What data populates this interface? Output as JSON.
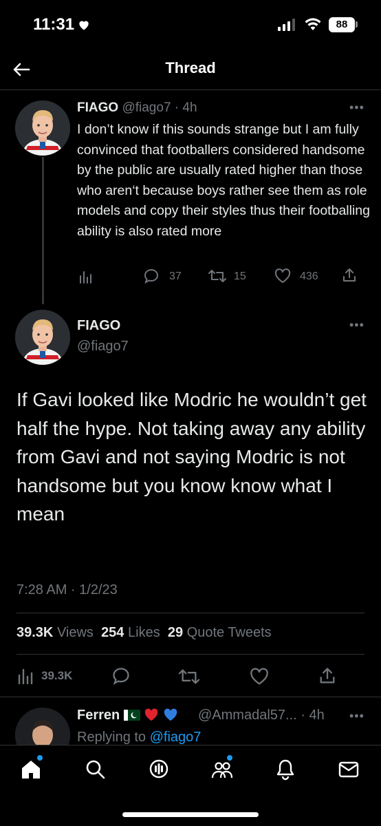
{
  "status_bar": {
    "time": "11:31",
    "battery": "88"
  },
  "header": {
    "title": "Thread"
  },
  "tweet1": {
    "name": "FIAGO",
    "handle": "@fiago7",
    "age": "4h",
    "text": "I don’t know if this sounds strange but I am fully convinced that footballers considered handsome by the public are usually rated higher than those who aren‘t because boys rather see them as role models and copy their styles thus their footballing ability is also rated more",
    "replies": "37",
    "retweets": "15",
    "likes": "436"
  },
  "main_tweet": {
    "name": "FIAGO",
    "handle": "@fiago7",
    "text": "If Gavi looked like Modric he wouldn’t get half the hype. Not taking away any ability from Gavi and not saying Modric is not handsome but you know know what I mean",
    "timestamp": "7:28 AM · 1/2/23",
    "views_count": "39.3K",
    "views_label": "Views",
    "likes_count": "254",
    "likes_label": "Likes",
    "quotes_count": "29",
    "quotes_label": "Quote Tweets",
    "action_views": "39.3K"
  },
  "reply": {
    "name": "Ferren",
    "handle": "@Ammadal57...",
    "age": "4h",
    "replying_prefix": "Replying to",
    "replying_to": "@fiago7"
  },
  "colors": {
    "background": "#000000",
    "text": "#e7e9ea",
    "muted": "#71767b",
    "accent": "#1d9bf0",
    "divider": "#2f3336",
    "heart_red": "#f91880"
  },
  "icons": {
    "status": [
      "heart-icon",
      "signal-icon",
      "wifi-icon",
      "battery-icon"
    ],
    "header": [
      "back-arrow-icon"
    ],
    "tweet_actions": [
      "views-icon",
      "reply-icon",
      "retweet-icon",
      "like-icon",
      "share-icon"
    ],
    "nav": [
      "home-icon",
      "search-icon",
      "spaces-icon",
      "communities-icon",
      "notifications-icon",
      "messages-icon"
    ]
  }
}
